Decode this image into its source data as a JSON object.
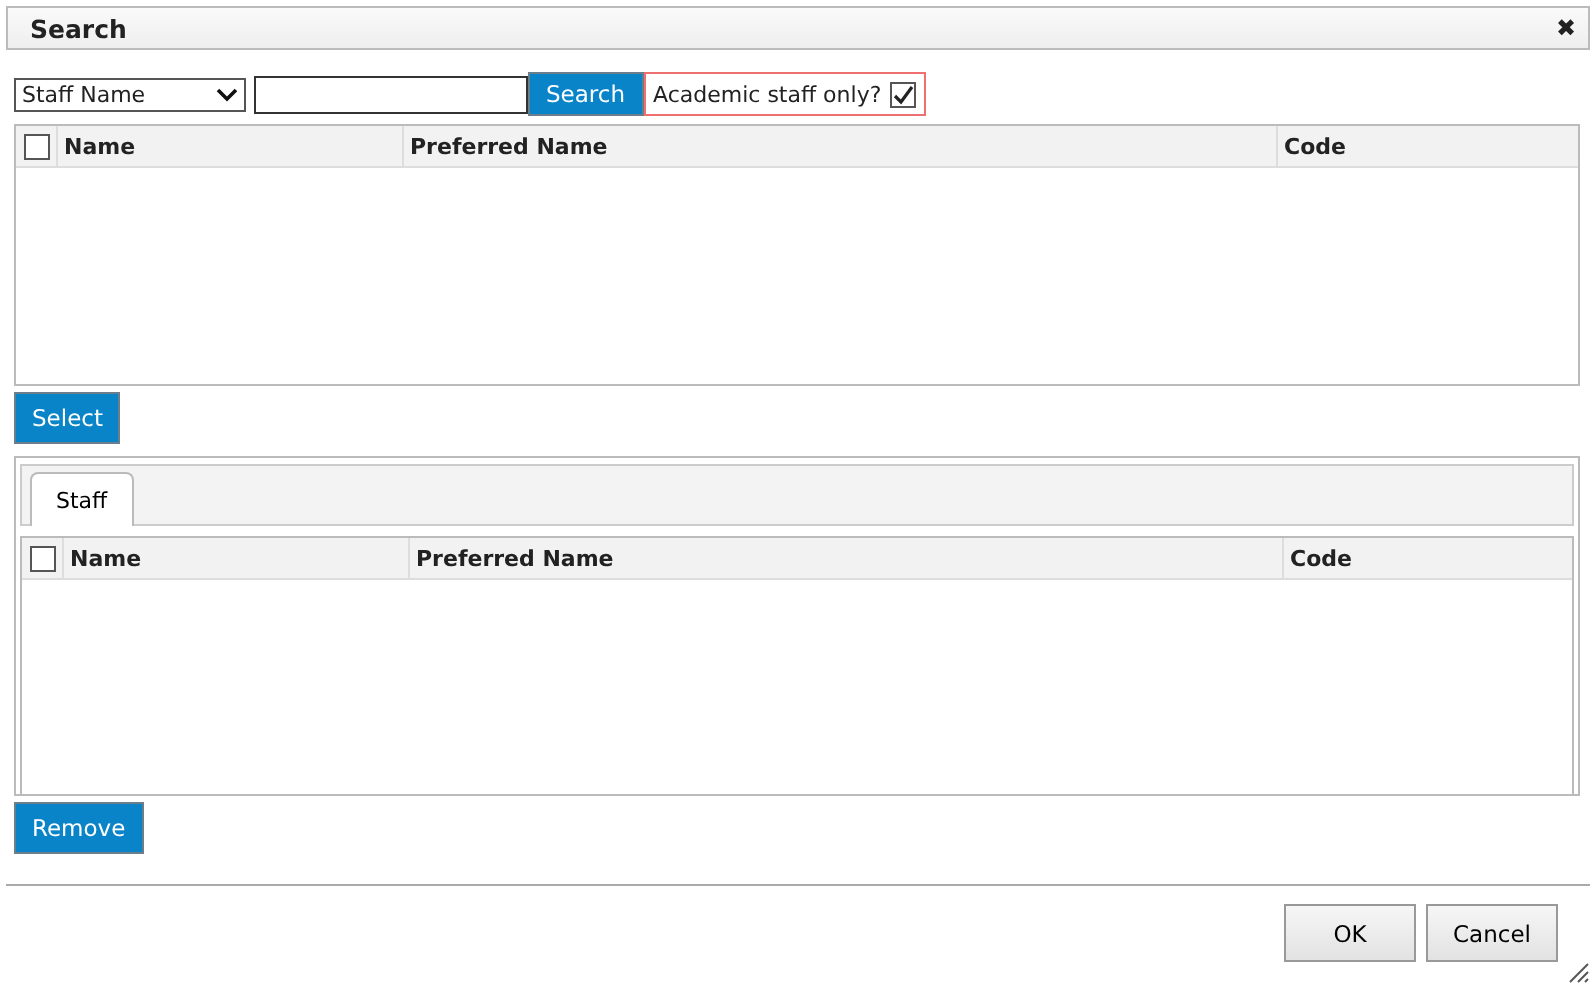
{
  "window": {
    "title": "Search",
    "close": "✖"
  },
  "search_bar": {
    "field_type": "Staff Name",
    "button": "Search",
    "academic_only": {
      "label": "Academic staff only?",
      "checked": true
    }
  },
  "results_table": {
    "all_checked": false,
    "columns": [
      "Name",
      "Preferred Name",
      "Code"
    ]
  },
  "select_button": "Select",
  "selected_panel": {
    "tabs": [
      {
        "label": "Staff",
        "selected": true
      }
    ],
    "all_checked": false,
    "columns": [
      "Name",
      "Preferred Name",
      "Code"
    ]
  },
  "remove_button": "Remove",
  "buttons": [
    "OK",
    "Cancel"
  ]
}
